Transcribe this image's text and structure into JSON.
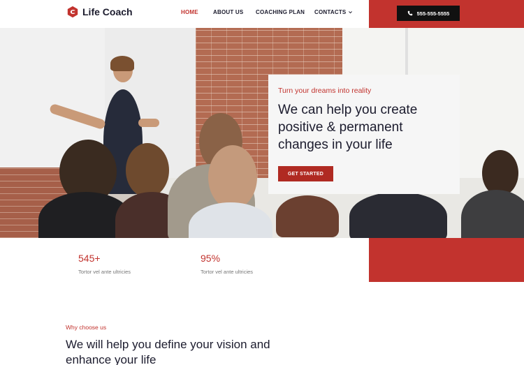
{
  "header": {
    "logo_text": "Life Coach",
    "nav": [
      {
        "label": "HOME",
        "active": true
      },
      {
        "label": "ABOUT US",
        "active": false
      },
      {
        "label": "COACHING PLAN",
        "active": false
      },
      {
        "label": "CONTACTS",
        "active": false
      }
    ],
    "phone": "555-555-5555"
  },
  "hero": {
    "eyebrow": "Turn your dreams into reality",
    "headline": "We can help you create positive & permanent changes in your life",
    "cta_label": "GET STARTED"
  },
  "stats": [
    {
      "value": "545+",
      "label": "Tortor vel ante ultricies"
    },
    {
      "value": "95%",
      "label": "Tortor vel ante ultricies"
    }
  ],
  "why": {
    "eyebrow": "Why choose us",
    "title": "We will help you define your vision and enhance your life"
  },
  "colors": {
    "accent": "#c2332e",
    "dark": "#1c1c2e",
    "cta": "#b02a22"
  },
  "icons": {
    "logo": "logo-mark-icon",
    "contacts_dropdown": "chevron-down-icon",
    "phone": "phone-icon"
  }
}
